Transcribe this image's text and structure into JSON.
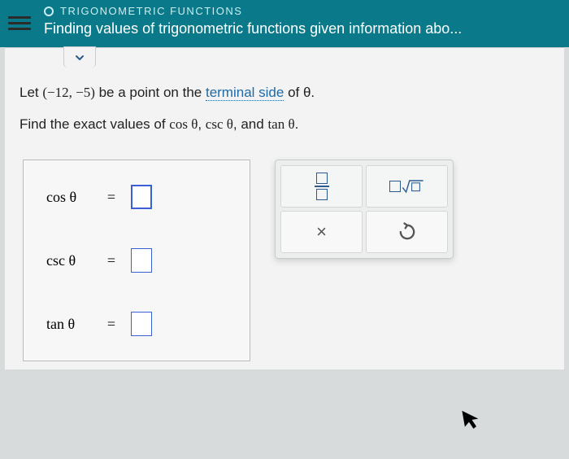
{
  "header": {
    "category": "TRIGONOMETRIC FUNCTIONS",
    "topic": "Finding values of trigonometric functions given information abo..."
  },
  "problem": {
    "line1_pre": "Let ",
    "point": "(−12, −5)",
    "line1_mid": " be a point on the ",
    "term_link": "terminal side",
    "line1_post": " of θ.",
    "line2_pre": "Find the exact values of ",
    "f1": "cos θ",
    "sep1": ", ",
    "f2": "csc θ",
    "sep2": ", and ",
    "f3": "tan θ",
    "end": "."
  },
  "answers": [
    {
      "label": "cos θ",
      "eq": "=",
      "active": true
    },
    {
      "label": "csc θ",
      "eq": "=",
      "active": false
    },
    {
      "label": "tan θ",
      "eq": "=",
      "active": false
    }
  ],
  "toolbox": {
    "frac_tooltip": "fraction",
    "sqrt_tooltip": "square root",
    "times": "×",
    "undo": "↺"
  }
}
